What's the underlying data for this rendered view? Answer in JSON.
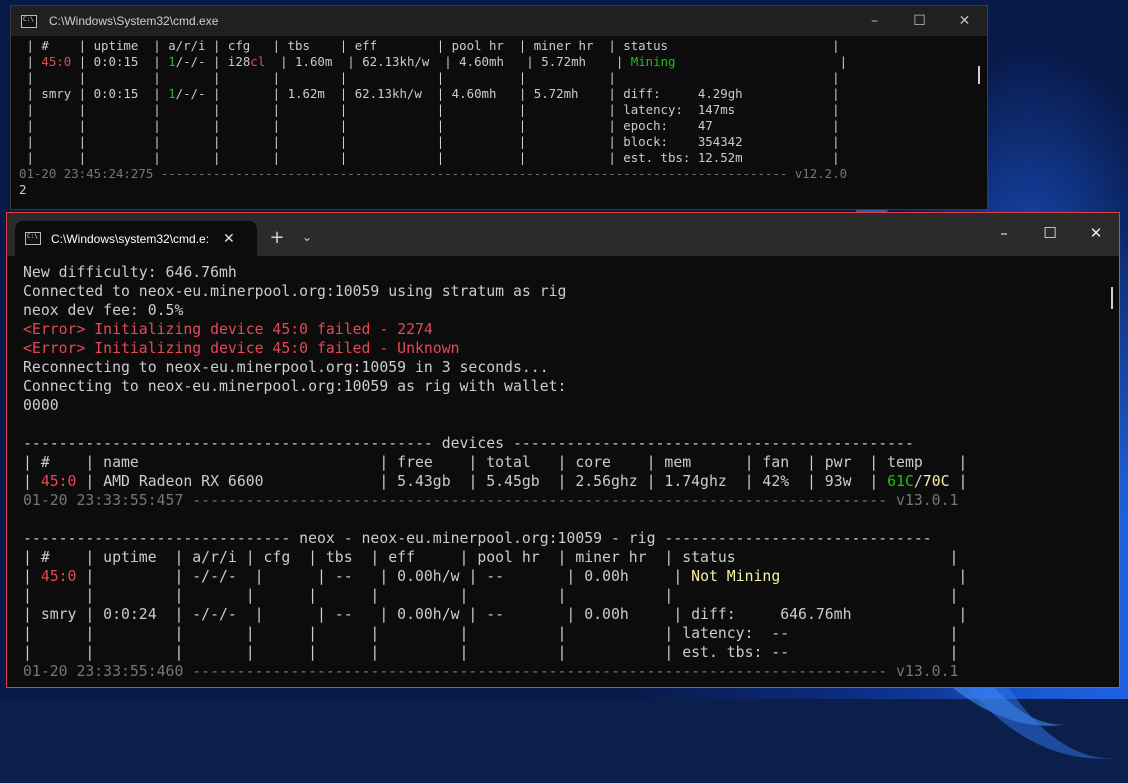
{
  "back_window": {
    "title": "C:\\Windows\\System32\\cmd.exe",
    "lines": [
      [
        {
          "t": " | #    | uptime  | a/r/i | cfg   | tbs    | eff        | pool hr  | miner hr  | status                      |"
        }
      ],
      [
        {
          "t": " | "
        },
        {
          "t": "45:0",
          "c": "red"
        },
        {
          "t": " | 0:0:15  | "
        },
        {
          "t": "1",
          "c": "green"
        },
        {
          "t": "/-/- | i28"
        },
        {
          "t": "cl",
          "c": "red"
        },
        {
          "t": "  | 1.60m  | 62.13kh/w  | 4.60mh   | 5.72mh    | "
        },
        {
          "t": "Mining",
          "c": "green"
        },
        {
          "t": "                      |"
        }
      ],
      [
        {
          "t": " |      |         |       |       |        |            |          |           |                             |"
        }
      ],
      [
        {
          "t": " | smry | 0:0:15  | "
        },
        {
          "t": "1",
          "c": "green"
        },
        {
          "t": "/-/- |       | 1.62m  | 62.13kh/w  | 4.60mh   | 5.72mh    | diff:     4.29gh            |"
        }
      ],
      [
        {
          "t": " |      |         |       |       |        |            |          |           | latency:  147ms             |"
        }
      ],
      [
        {
          "t": " |      |         |       |       |        |            |          |           | epoch:    47                |"
        }
      ],
      [
        {
          "t": " |      |         |       |       |        |            |          |           | block:    354342            |"
        }
      ],
      [
        {
          "t": " |      |         |       |       |        |            |          |           | est. tbs: 12.52m            |"
        }
      ],
      [
        {
          "t": "01-20 23:45:24:275 ------------------------------------------------------------------------------------ v12.2.0",
          "c": "dim"
        }
      ],
      [
        {
          "t": "2"
        }
      ]
    ]
  },
  "front_window": {
    "tab_title": "C:\\Windows\\system32\\cmd.e:",
    "newtab_label": "+",
    "dropdown_label": "⌄",
    "lines": [
      [
        {
          "t": "New difficulty: 646.76mh"
        }
      ],
      [
        {
          "t": "Connected to neox-eu.minerpool.org:10059 using stratum as rig"
        }
      ],
      [
        {
          "t": "neox dev fee: 0.5%"
        }
      ],
      [
        {
          "t": "<Error> Initializing device 45:0 failed - 2274",
          "c": "red"
        }
      ],
      [
        {
          "t": "<Error> Initializing device 45:0 failed - Unknown",
          "c": "red"
        }
      ],
      [
        {
          "t": "Reconnecting to neox-eu.minerpool.org:10059 in 3 seconds..."
        }
      ],
      [
        {
          "t": "Connecting to neox-eu.minerpool.org:10059 as rig with wallet:"
        }
      ],
      [
        {
          "t": "0000"
        }
      ],
      [
        {
          "t": ""
        }
      ],
      [
        {
          "t": "---------------------------------------------- devices ---------------------------------------------"
        }
      ],
      [
        {
          "t": "| #    | name                           | free    | total   | core    | mem      | fan  | pwr  | temp    |"
        }
      ],
      [
        {
          "t": "| "
        },
        {
          "t": "45:0",
          "c": "red"
        },
        {
          "t": " | AMD Radeon RX 6600             | 5.43gb  | 5.45gb  | 2.56ghz | 1.74ghz  | 42%  | 93w  | "
        },
        {
          "t": "61C",
          "c": "green"
        },
        {
          "t": "/"
        },
        {
          "t": "70C",
          "c": "yellow"
        },
        {
          "t": " |"
        }
      ],
      [
        {
          "t": "01-20 23:33:55:457 ------------------------------------------------------------------------------ v13.0.1",
          "c": "dim"
        }
      ],
      [
        {
          "t": ""
        }
      ],
      [
        {
          "t": "------------------------------ neox - neox-eu.minerpool.org:10059 - rig ------------------------------"
        }
      ],
      [
        {
          "t": "| #    | uptime  | a/r/i | cfg  | tbs  | eff     | pool hr  | miner hr  | status                        |"
        }
      ],
      [
        {
          "t": "| "
        },
        {
          "t": "45:0",
          "c": "red"
        },
        {
          "t": " |         | -/-/-  |      | --   | 0.00h/w | --       | 0.00h     | "
        },
        {
          "t": "Not Mining",
          "c": "yellow"
        },
        {
          "t": "                    |"
        }
      ],
      [
        {
          "t": "|      |         |       |      |      |         |          |           |                               |"
        }
      ],
      [
        {
          "t": "| smry | 0:0:24  | -/-/-  |      | --   | 0.00h/w | --       | 0.00h     | diff:     646.76mh            |"
        }
      ],
      [
        {
          "t": "|      |         |       |      |      |         |          |           | latency:  --                  |"
        }
      ],
      [
        {
          "t": "|      |         |       |      |      |         |          |           | est. tbs: --                  |"
        }
      ],
      [
        {
          "t": "01-20 23:33:55:460 ------------------------------------------------------------------------------ v13.0.1",
          "c": "dim"
        }
      ]
    ]
  },
  "controls": {
    "minimize": "–",
    "maximize": "☐",
    "close": "✕",
    "tab_close": "✕",
    "cmd_icon_text": "C:\\"
  },
  "icons": [
    "cmd-icon",
    "minimize-icon",
    "maximize-icon",
    "close-icon",
    "plus-icon",
    "chevron-down-icon"
  ],
  "colors": {
    "error": "#e74856",
    "ok": "#16c60c",
    "warn": "#f9f1a5",
    "text": "#cccccc",
    "active_border": "#e04040"
  }
}
